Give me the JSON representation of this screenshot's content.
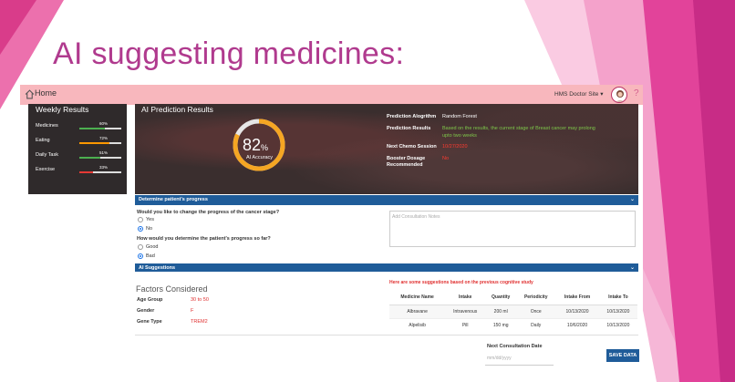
{
  "slide": {
    "title": "AI suggesting medicines:"
  },
  "topbar": {
    "home_label": "Home",
    "site_label": "HMS Doctor Site ▾",
    "help": "?"
  },
  "weekly": {
    "title": "Weekly Results",
    "items": [
      {
        "label": "Medicines",
        "percent": "60%",
        "value": 0.6,
        "color": "#4caf50"
      },
      {
        "label": "Eating",
        "percent": "72%",
        "value": 0.72,
        "color": "#ff9800"
      },
      {
        "label": "Daily Task",
        "percent": "51%",
        "value": 0.51,
        "color": "#4caf50"
      },
      {
        "label": "Exercise",
        "percent": "33%",
        "value": 0.33,
        "color": "#e53935"
      }
    ]
  },
  "prediction": {
    "title": "AI Prediction Results",
    "accuracy_value": "82",
    "accuracy_unit": "%",
    "accuracy_fraction": 0.82,
    "accuracy_label": "AI Accuracy",
    "algorithm_key": "Prediction Alogrithm",
    "algorithm_value": "Random Forest",
    "results_key": "Prediction Results",
    "results_value_line1": "Based on the results, the current stage of Breast cancer may prolong",
    "results_value_line2": "upto two weeks",
    "chemo_key": "Next Chemo Session",
    "chemo_value": "10/27/2020",
    "booster_key_line1": "Booster Dosage",
    "booster_key_line2": "Recommended",
    "booster_value": "No",
    "gauge_color": "#f5a623"
  },
  "progress": {
    "bar_title": "Determine patient's progress",
    "q1": "Would you like to change the progress of the cancer stage?",
    "q1_opts": [
      "Yes",
      "No"
    ],
    "q1_selected": "No",
    "q2": "How would you determine the patient's progress so far?",
    "q2_opts": [
      "Good",
      "Bad"
    ],
    "q2_selected": "Bad",
    "notes_placeholder": "Add Consultation Notes"
  },
  "suggestions": {
    "bar_title": "AI Suggestions",
    "factors_title": "Factors Considered",
    "factors": [
      {
        "key": "Age Group",
        "value": "30 to 50"
      },
      {
        "key": "Gender",
        "value": "F"
      },
      {
        "key": "Gene Type",
        "value": "TREM2"
      }
    ],
    "hint": "Here are some suggestions based on the previous cognitive study",
    "columns": [
      "Medicine Name",
      "Intake",
      "Quantity",
      "Periodicity",
      "Intake From",
      "Intake To"
    ],
    "rows": [
      [
        "Albravane",
        "Intravenous",
        "200 ml",
        "Once",
        "10/13/2020",
        "10/13/2020"
      ],
      [
        "Alpelisib",
        "Pill",
        "150 mg",
        "Daily",
        "10/6/2020",
        "10/13/2020"
      ]
    ]
  },
  "consult": {
    "next_label": "Next Consultation Date",
    "date_placeholder": "mm/dd/yyyy",
    "save_label": "SAVE DATA"
  }
}
